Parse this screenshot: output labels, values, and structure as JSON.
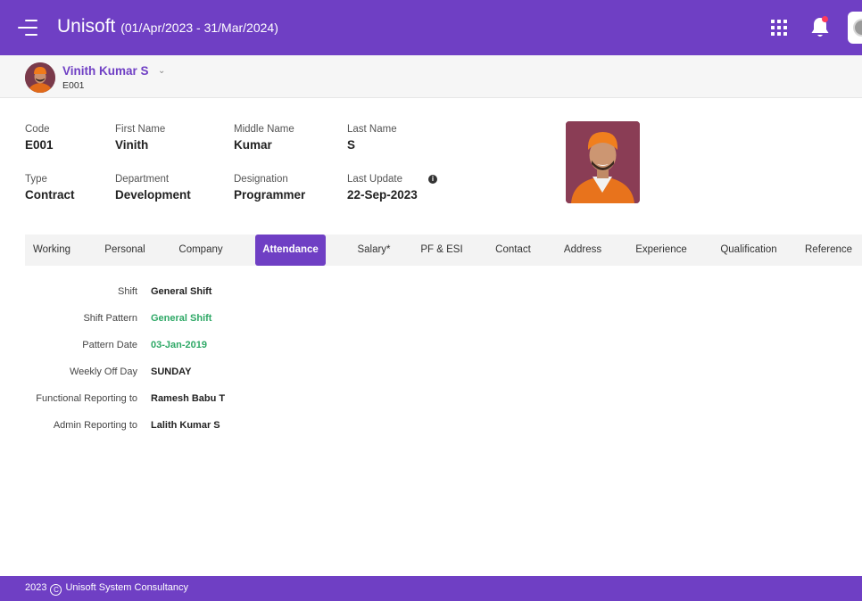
{
  "header": {
    "app_name": "Unisoft",
    "period": "(01/Apr/2023 - 31/Mar/2024)"
  },
  "employee_selector": {
    "name": "Vinith Kumar S",
    "code": "E001"
  },
  "info": {
    "code": {
      "label": "Code",
      "value": "E001"
    },
    "first_name": {
      "label": "First Name",
      "value": "Vinith"
    },
    "middle_name": {
      "label": "Middle Name",
      "value": "Kumar"
    },
    "last_name": {
      "label": "Last Name",
      "value": "S"
    },
    "type": {
      "label": "Type",
      "value": "Contract"
    },
    "department": {
      "label": "Department",
      "value": "Development"
    },
    "designation": {
      "label": "Designation",
      "value": "Programmer"
    },
    "last_update": {
      "label": "Last Update",
      "value": "22-Sep-2023"
    }
  },
  "tabs": [
    {
      "label": "Working"
    },
    {
      "label": "Personal"
    },
    {
      "label": "Company"
    },
    {
      "label": "Attendance",
      "active": true
    },
    {
      "label": "Salary*"
    },
    {
      "label": "PF & ESI"
    },
    {
      "label": "Contact"
    },
    {
      "label": "Address"
    },
    {
      "label": "Experience"
    },
    {
      "label": "Qualification"
    },
    {
      "label": "Reference"
    }
  ],
  "attendance": [
    {
      "label": "Shift",
      "value": "General Shift"
    },
    {
      "label": "Shift Pattern",
      "value": "General Shift"
    },
    {
      "label": "Pattern Date",
      "value": "03-Jan-2019"
    },
    {
      "label": "Weekly Off Day",
      "value": "SUNDAY"
    },
    {
      "label": "Functional Reporting to",
      "value": "Ramesh Babu T"
    },
    {
      "label": "Admin Reporting to",
      "value": "Lalith Kumar S"
    }
  ],
  "footer": {
    "year": "2023",
    "company": "Unisoft System Consultancy"
  },
  "colors": {
    "brand": "#6f3fc4",
    "link_green": "#2ea866",
    "notification": "#ff3b5c"
  }
}
